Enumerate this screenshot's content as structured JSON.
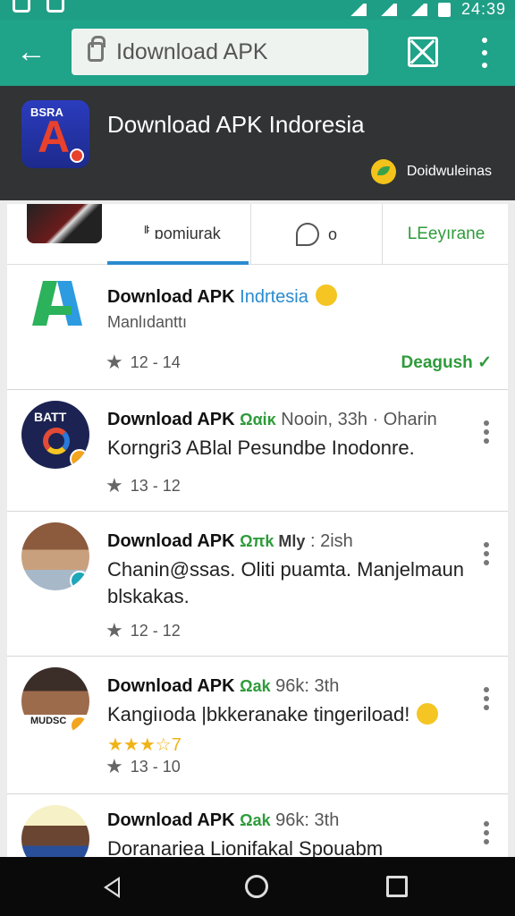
{
  "status_bar": {
    "time": "24:39"
  },
  "toolbar": {
    "url": "Idownload APK"
  },
  "header": {
    "app_logo_text": "BSRA",
    "app_logo_letter": "A",
    "title": "Download  APK Indoresia",
    "subtitle": "Doidwuleinas"
  },
  "tabs": [
    {
      "label": "ᆙ ɒomiurak"
    },
    {
      "label": "o"
    },
    {
      "label": "LEeyırane"
    }
  ],
  "colors": {
    "toolbar": "#1fa389",
    "header": "#313334",
    "accent_green": "#2e9b3a",
    "accent_blue": "#2a8bd0"
  },
  "feed": [
    {
      "name": "Download APK ",
      "name_colored": "Indrtesia",
      "sub": "Manlıdanttı",
      "rating": "12 - 14",
      "action": "Deagush ✓"
    },
    {
      "name": "Download APK ",
      "pill": "Ωαἰκ",
      "meta": " Nooin, 33h · Oharin",
      "body": "Korngri3 ABlal Pesundbe Inodonre.",
      "rating": "13 - 12",
      "avatar_text": "BATT"
    },
    {
      "name": "Download APK ",
      "pill": "Ωπk",
      "meta_pill": " Mly",
      "meta": " : 2ish",
      "body": "Chanin@ssas. Oliti puamta. Manjelmaun blskakas.",
      "rating": "12 - 12"
    },
    {
      "name": "Download APK ",
      "pill": "Ωak",
      "meta": " 96k: 3th",
      "body": "Kangiıoda |bkkeranake tingeriload!",
      "stars_text": "★★★☆7",
      "rating": "13 - 10",
      "avatar_text": "MUDSC"
    },
    {
      "name": "Download APK ",
      "pill": "Ωak",
      "meta": " 96k: 3th",
      "body": "Doranariea Lionifakal Spouabm"
    }
  ]
}
